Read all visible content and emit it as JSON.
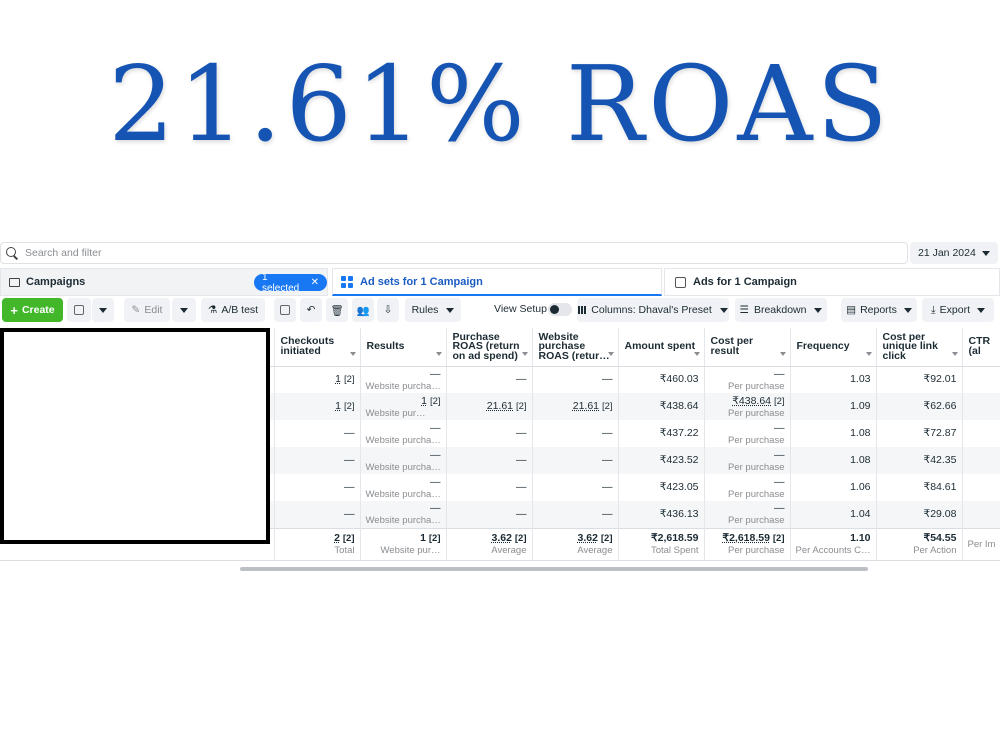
{
  "headline": "21.61% ROAS",
  "search": {
    "placeholder": "Search and filter"
  },
  "date": {
    "label": "21 Jan 2024"
  },
  "tabs": {
    "campaigns": "Campaigns",
    "selected": "1 selected",
    "adsets": "Ad sets for 1 Campaign",
    "ads": "Ads for 1 Campaign"
  },
  "toolbar": {
    "create": "Create",
    "edit": "Edit",
    "ab_test": "A/B test",
    "rules": "Rules",
    "view_setup": "View Setup",
    "columns": "Columns: Dhaval's Preset",
    "breakdown": "Breakdown",
    "reports": "Reports",
    "export": "Export"
  },
  "columns": [
    "Checkouts initiated",
    "Results",
    "Purchase ROAS (return on ad spend)",
    "Website purchase ROAS (retur…",
    "Amount spent",
    "Cost per result",
    "Frequency",
    "Cost per unique link click",
    "CTR (al"
  ],
  "rows": [
    {
      "checkouts": "1",
      "checkouts_ref": "[2]",
      "results": "—",
      "results_sub": "Website purcha…",
      "roas": "—",
      "web_roas": "—",
      "spent": "₹460.03",
      "cpr": "—",
      "cpr_sub": "Per purchase",
      "freq": "1.03",
      "cpulc": "₹92.01"
    },
    {
      "checkouts": "1",
      "checkouts_ref": "[2]",
      "results": "1",
      "results_ref": "[2]",
      "results_sub": "Website pur…",
      "roas": "21.61",
      "roas_ref": "[2]",
      "web_roas": "21.61",
      "web_roas_ref": "[2]",
      "spent": "₹438.64",
      "cpr": "₹438.64",
      "cpr_ref": "[2]",
      "cpr_sub": "Per purchase",
      "freq": "1.09",
      "cpulc": "₹62.66"
    },
    {
      "checkouts": "—",
      "results": "—",
      "results_sub": "Website purcha…",
      "roas": "—",
      "web_roas": "—",
      "spent": "₹437.22",
      "cpr": "—",
      "cpr_sub": "Per purchase",
      "freq": "1.08",
      "cpulc": "₹72.87"
    },
    {
      "checkouts": "—",
      "results": "—",
      "results_sub": "Website purcha…",
      "roas": "—",
      "web_roas": "—",
      "spent": "₹423.52",
      "cpr": "—",
      "cpr_sub": "Per purchase",
      "freq": "1.08",
      "cpulc": "₹42.35"
    },
    {
      "checkouts": "—",
      "results": "—",
      "results_sub": "Website purcha…",
      "roas": "—",
      "web_roas": "—",
      "spent": "₹423.05",
      "cpr": "—",
      "cpr_sub": "Per purchase",
      "freq": "1.06",
      "cpulc": "₹84.61"
    },
    {
      "checkouts": "—",
      "results": "—",
      "results_sub": "Website purcha…",
      "roas": "—",
      "web_roas": "—",
      "spent": "₹436.13",
      "cpr": "—",
      "cpr_sub": "Per purchase",
      "freq": "1.04",
      "cpulc": "₹29.08"
    }
  ],
  "totals": {
    "checkouts": "2",
    "checkouts_ref": "[2]",
    "checkouts_sub": "Total",
    "results": "1",
    "results_ref": "[2]",
    "results_sub": "Website pur…",
    "roas": "3.62",
    "roas_ref": "[2]",
    "roas_sub": "Average",
    "web_roas": "3.62",
    "web_roas_ref": "[2]",
    "web_roas_sub": "Average",
    "spent": "₹2,618.59",
    "spent_sub": "Total Spent",
    "cpr": "₹2,618.59",
    "cpr_ref": "[2]",
    "cpr_sub": "Per purchase",
    "freq": "1.10",
    "freq_sub": "Per Accounts C…",
    "cpulc": "₹54.55",
    "cpulc_sub": "Per Action",
    "ctr_sub": "Per Im"
  },
  "colors": {
    "accent": "#1877f2",
    "create": "#42b72a",
    "headline": "#1554b3"
  }
}
